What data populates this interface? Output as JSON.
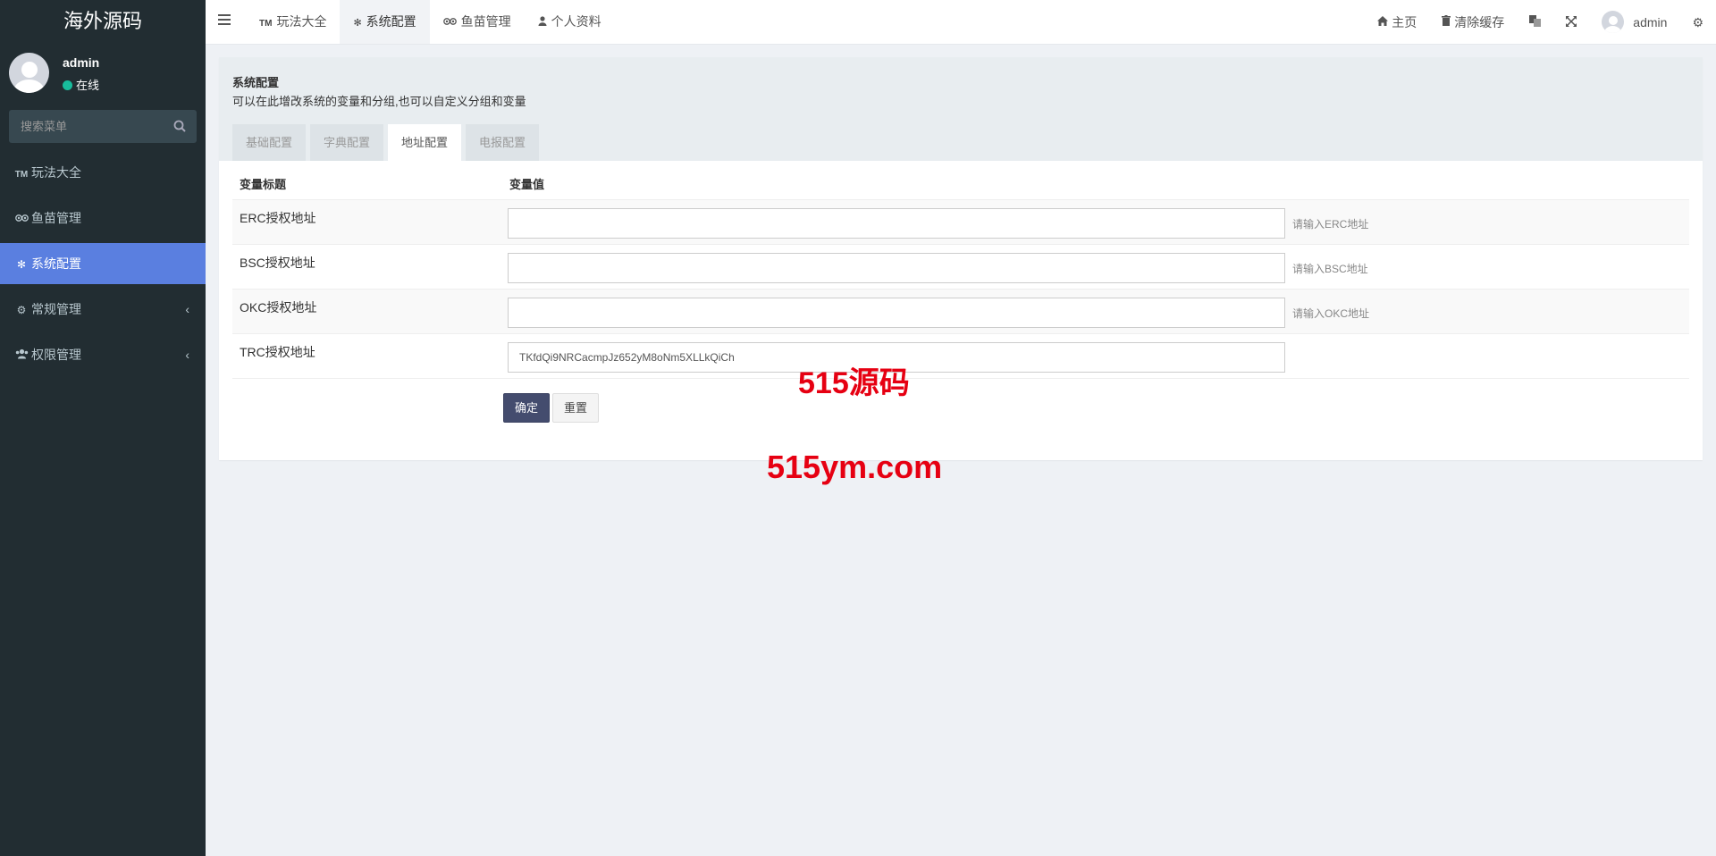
{
  "sidebar": {
    "logo": "海外源码",
    "user": {
      "name": "admin",
      "status": "在线"
    },
    "search_placeholder": "搜索菜单",
    "items": [
      {
        "icon": "TM",
        "label": "玩法大全"
      },
      {
        "icon": "tripadvisor-icon",
        "label": "鱼苗管理"
      },
      {
        "icon": "gear-icon",
        "label": "系统配置",
        "active": true
      },
      {
        "icon": "cogs-icon",
        "label": "常规管理",
        "caret": "‹"
      },
      {
        "icon": "users-icon",
        "label": "权限管理",
        "caret": "‹"
      }
    ]
  },
  "navbar": {
    "tabs": [
      {
        "icon": "TM",
        "label": "玩法大全"
      },
      {
        "icon": "gear-icon",
        "label": "系统配置",
        "active": true
      },
      {
        "icon": "tripadvisor-icon",
        "label": "鱼苗管理"
      },
      {
        "icon": "user-icon",
        "label": "个人资料"
      }
    ],
    "right": {
      "home": "主页",
      "clear_cache": "清除缓存",
      "username": "admin"
    }
  },
  "panel": {
    "title": "系统配置",
    "description": "可以在此增改系统的变量和分组,也可以自定义分组和变量",
    "tabs": [
      "基础配置",
      "字典配置",
      "地址配置",
      "电报配置"
    ],
    "active_tab": "地址配置",
    "table": {
      "col_title": "变量标题",
      "col_value": "变量值",
      "rows": [
        {
          "label": "ERC授权地址",
          "value": "",
          "hint": "请输入ERC地址"
        },
        {
          "label": "BSC授权地址",
          "value": "",
          "hint": "请输入BSC地址"
        },
        {
          "label": "OKC授权地址",
          "value": "",
          "hint": "请输入OKC地址"
        },
        {
          "label": "TRC授权地址",
          "value": "TKfdQi9NRCacmpJz652yM8oNm5XLLkQiCh",
          "hint": ""
        }
      ]
    },
    "submit_label": "确定",
    "reset_label": "重置"
  },
  "watermarks": [
    "515源码",
    "515ym.com"
  ],
  "colors": {
    "sidebar_bg": "#222d32",
    "active_menu": "#5a7fe0",
    "primary_button": "#444c6e",
    "watermark": "#e60012"
  }
}
